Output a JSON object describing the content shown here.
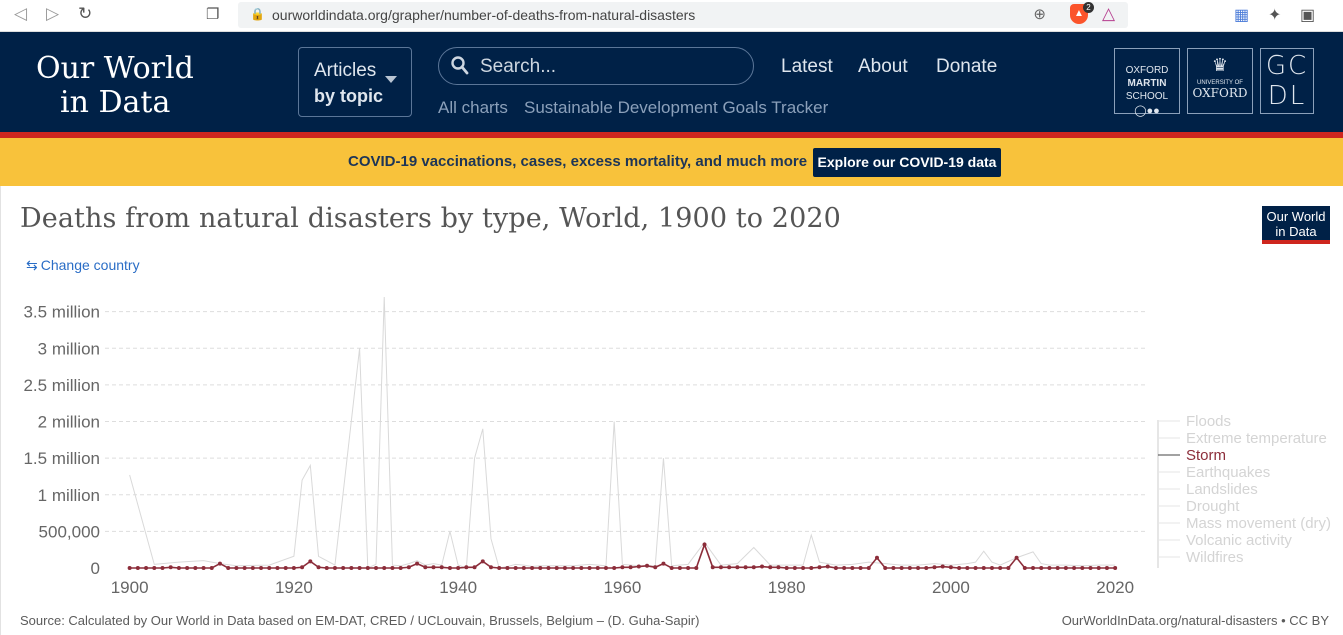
{
  "browser": {
    "url": "ourworldindata.org/grapher/number-of-deaths-from-natural-disasters",
    "brave_badge": "2"
  },
  "header": {
    "logo_line1": "Our World",
    "logo_line2": "in Data",
    "topics_line1": "Articles",
    "topics_line2": "by topic",
    "search_placeholder": "Search...",
    "nav": [
      "Latest",
      "About",
      "Donate"
    ],
    "sub_nav": [
      "All charts",
      "Sustainable Development Goals Tracker"
    ],
    "oxford_martin": [
      "OXFORD",
      "MARTIN",
      "SCHOOL"
    ],
    "uni_oxford": [
      "UNIVERSITY OF",
      "OXFORD"
    ],
    "gcdl": [
      "GC",
      "DL"
    ]
  },
  "banner": {
    "text": "COVID-19 vaccinations, cases, excess mortality, and much more",
    "button": "Explore our COVID-19 data"
  },
  "chart": {
    "change_country": "Change country",
    "badge_line1": "Our World",
    "badge_line2": "in Data",
    "source": "Source: Calculated by Our World in Data based on EM-DAT, CRED / UCLouvain, Brussels, Belgium – (D. Guha-Sapir)",
    "license": "OurWorldInData.org/natural-disasters • CC BY"
  },
  "chart_data": {
    "type": "line",
    "title": "Deaths from natural disasters by type, World, 1900 to 2020",
    "xlabel": "",
    "ylabel": "",
    "xlim": [
      1897,
      2024
    ],
    "ylim": [
      0,
      3700000
    ],
    "x_ticks": [
      1900,
      1920,
      1940,
      1960,
      1980,
      2000,
      2020
    ],
    "y_ticks": [
      0,
      500000,
      1000000,
      1500000,
      2000000,
      2500000,
      3000000,
      3500000
    ],
    "y_tick_labels": [
      "0",
      "500,000",
      "1 million",
      "1.5 million",
      "2 million",
      "2.5 million",
      "3 million",
      "3.5 million"
    ],
    "grid": "horizontal dashed",
    "legend_position": "right",
    "highlighted_series": "Storm",
    "colors": {
      "highlight": "#8c2d3a",
      "muted": "#d9d9d9",
      "legend_muted": "#d4d4d4"
    },
    "legend": [
      "Floods",
      "Extreme temperature",
      "Storm",
      "Earthquakes",
      "Landslides",
      "Drought",
      "Mass movement (dry)",
      "Volcanic activity",
      "Wildfires"
    ],
    "series": [
      {
        "name": "Storm",
        "x": [
          1900,
          1901,
          1902,
          1903,
          1904,
          1905,
          1906,
          1907,
          1908,
          1909,
          1910,
          1911,
          1912,
          1913,
          1914,
          1915,
          1916,
          1917,
          1918,
          1919,
          1920,
          1921,
          1922,
          1923,
          1924,
          1925,
          1926,
          1927,
          1928,
          1929,
          1930,
          1931,
          1932,
          1933,
          1934,
          1935,
          1936,
          1937,
          1938,
          1939,
          1940,
          1941,
          1942,
          1943,
          1944,
          1945,
          1946,
          1947,
          1948,
          1949,
          1950,
          1951,
          1952,
          1953,
          1954,
          1955,
          1956,
          1957,
          1958,
          1959,
          1960,
          1961,
          1962,
          1963,
          1964,
          1965,
          1966,
          1967,
          1968,
          1969,
          1970,
          1971,
          1972,
          1973,
          1974,
          1975,
          1976,
          1977,
          1978,
          1979,
          1980,
          1981,
          1982,
          1983,
          1984,
          1985,
          1986,
          1987,
          1988,
          1989,
          1990,
          1991,
          1992,
          1993,
          1994,
          1995,
          1996,
          1997,
          1998,
          1999,
          2000,
          2001,
          2002,
          2003,
          2004,
          2005,
          2006,
          2007,
          2008,
          2009,
          2010,
          2011,
          2012,
          2013,
          2014,
          2015,
          2016,
          2017,
          2018,
          2019,
          2020
        ],
        "values": [
          0,
          0,
          0,
          0,
          0,
          10000,
          0,
          0,
          0,
          0,
          0,
          60000,
          0,
          0,
          0,
          0,
          0,
          0,
          0,
          0,
          0,
          10000,
          90000,
          10000,
          0,
          0,
          0,
          0,
          0,
          0,
          0,
          0,
          0,
          0,
          10000,
          60000,
          10000,
          10000,
          10000,
          0,
          0,
          10000,
          10000,
          90000,
          10000,
          0,
          0,
          0,
          0,
          0,
          0,
          0,
          0,
          0,
          0,
          0,
          0,
          0,
          0,
          0,
          10000,
          10000,
          20000,
          30000,
          10000,
          60000,
          0,
          0,
          0,
          0,
          320000,
          10000,
          10000,
          10000,
          10000,
          10000,
          10000,
          20000,
          10000,
          10000,
          0,
          0,
          0,
          0,
          10000,
          20000,
          0,
          0,
          0,
          0,
          0,
          140000,
          0,
          0,
          0,
          0,
          0,
          0,
          10000,
          20000,
          10000,
          0,
          0,
          0,
          0,
          0,
          0,
          0,
          140000,
          0,
          0,
          0,
          0,
          0,
          0,
          0,
          0,
          0,
          0,
          0,
          0
        ]
      },
      {
        "name": "Other disaster types (muted)",
        "x": [
          1900,
          1903,
          1906,
          1909,
          1911,
          1913,
          1917,
          1920,
          1921,
          1922,
          1923,
          1925,
          1928,
          1929,
          1930,
          1931,
          1932,
          1933,
          1934,
          1935,
          1936,
          1937,
          1938,
          1939,
          1940,
          1941,
          1942,
          1943,
          1944,
          1945,
          1946,
          1947,
          1948,
          1949,
          1950,
          1952,
          1954,
          1956,
          1958,
          1959,
          1960,
          1962,
          1964,
          1965,
          1966,
          1968,
          1970,
          1972,
          1974,
          1976,
          1978,
          1980,
          1982,
          1983,
          1984,
          1986,
          1988,
          1990,
          1992,
          1994,
          1996,
          1998,
          2000,
          2002,
          2003,
          2004,
          2005,
          2006,
          2008,
          2010,
          2011,
          2012,
          2014,
          2016,
          2018,
          2020
        ],
        "values": [
          1270000,
          50000,
          80000,
          100000,
          60000,
          30000,
          40000,
          160000,
          1200000,
          1400000,
          160000,
          40000,
          3000000,
          0,
          50000,
          3700000,
          40000,
          30000,
          60000,
          100000,
          40000,
          60000,
          40000,
          500000,
          40000,
          0,
          1500000,
          1900000,
          400000,
          0,
          20000,
          50000,
          40000,
          20000,
          30000,
          30000,
          30000,
          50000,
          30000,
          2000000,
          50000,
          30000,
          30000,
          1500000,
          30000,
          50000,
          350000,
          40000,
          60000,
          280000,
          40000,
          40000,
          40000,
          450000,
          80000,
          40000,
          50000,
          80000,
          60000,
          40000,
          40000,
          60000,
          40000,
          60000,
          80000,
          230000,
          80000,
          40000,
          140000,
          220000,
          60000,
          40000,
          40000,
          30000,
          40000,
          40000
        ]
      }
    ]
  }
}
